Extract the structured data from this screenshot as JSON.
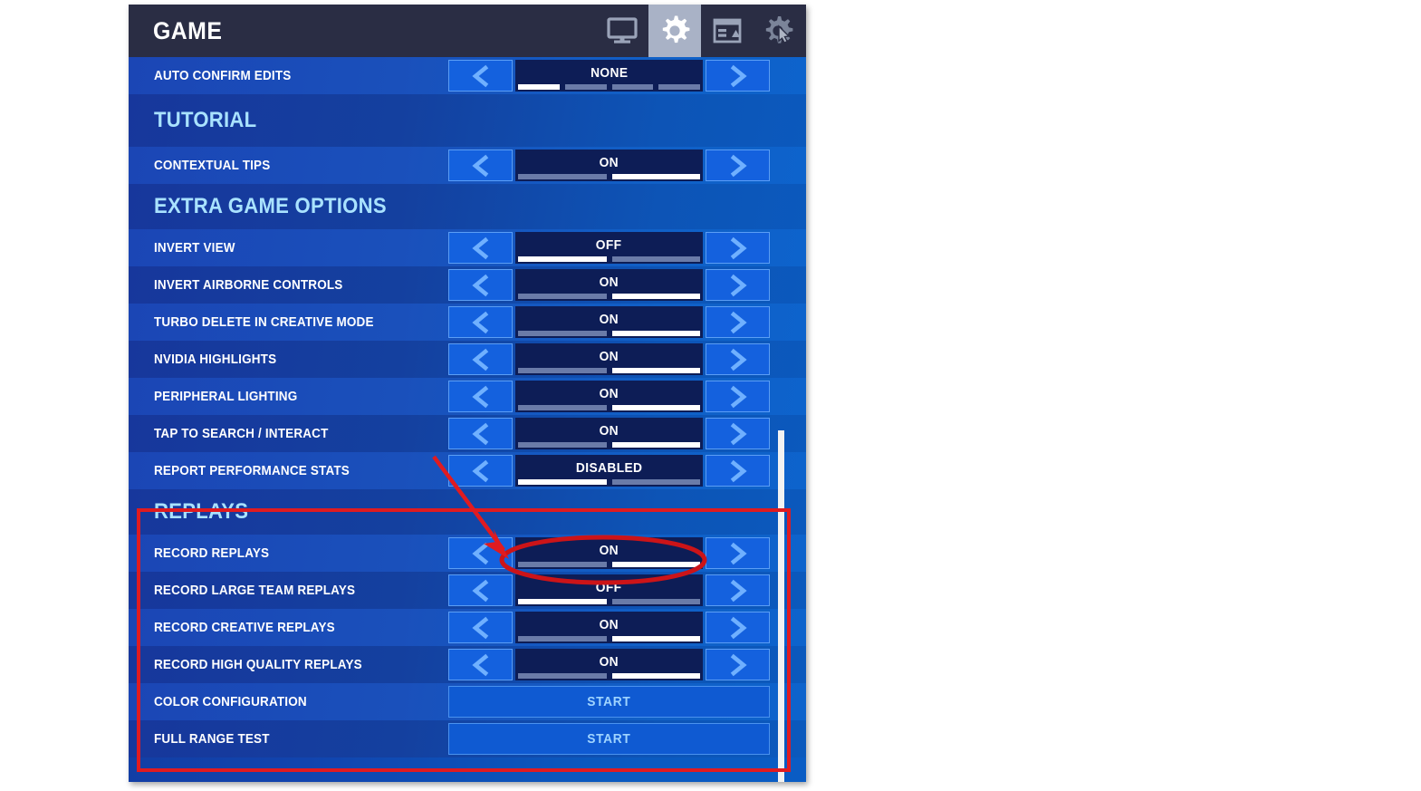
{
  "header": {
    "title": "GAME",
    "icons": [
      {
        "name": "display-icon",
        "label": "Video",
        "active": false
      },
      {
        "name": "gear-icon",
        "label": "Game",
        "active": true
      },
      {
        "name": "hud-layout-icon",
        "label": "HUD Layout",
        "active": false
      },
      {
        "name": "gear-cursor-icon",
        "label": "Input",
        "active": false
      }
    ]
  },
  "colors": {
    "panel_gradient_start": "#123a9e",
    "panel_gradient_end": "#0a5cc4",
    "header_bg": "#2a2d44",
    "section_title": "#a9e2ff",
    "row_label": "#ffffff",
    "value_box_bg": "#0d1d56",
    "arrow_btn_bg": "#1461de",
    "arrow_glyph": "#6fb0ff",
    "segment_active": "#ffffff",
    "segment_inactive": "#6a7ba8",
    "start_text": "#9fd4ff",
    "annotation_red": "#e01b20",
    "scrollbar": "#f2f2f2"
  },
  "rows": [
    {
      "id": "auto-confirm-edits",
      "label": "AUTO CONFIRM EDITS",
      "type": "stepper",
      "value": "NONE",
      "segments": 4,
      "active_segment": 1,
      "shade": "light"
    }
  ],
  "sections": [
    {
      "id": "tutorial",
      "title": "TUTORIAL",
      "rows": [
        {
          "id": "contextual-tips",
          "label": "CONTEXTUAL TIPS",
          "type": "stepper",
          "value": "ON",
          "segments": 2,
          "active_segment": 2,
          "shade": "light"
        }
      ]
    },
    {
      "id": "extra-game-options",
      "title": "EXTRA GAME OPTIONS",
      "rows": [
        {
          "id": "invert-view",
          "label": "INVERT VIEW",
          "type": "stepper",
          "value": "OFF",
          "segments": 2,
          "active_segment": 1,
          "shade": "light"
        },
        {
          "id": "invert-airborne-controls",
          "label": "INVERT AIRBORNE CONTROLS",
          "type": "stepper",
          "value": "ON",
          "segments": 2,
          "active_segment": 2,
          "shade": "dark"
        },
        {
          "id": "turbo-delete-in-creative-mode",
          "label": "TURBO DELETE IN CREATIVE MODE",
          "type": "stepper",
          "value": "ON",
          "segments": 2,
          "active_segment": 2,
          "shade": "light"
        },
        {
          "id": "nvidia-highlights",
          "label": "NVIDIA HIGHLIGHTS",
          "type": "stepper",
          "value": "ON",
          "segments": 2,
          "active_segment": 2,
          "shade": "dark"
        },
        {
          "id": "peripheral-lighting",
          "label": "PERIPHERAL LIGHTING",
          "type": "stepper",
          "value": "ON",
          "segments": 2,
          "active_segment": 2,
          "shade": "light"
        },
        {
          "id": "tap-to-search-interact",
          "label": "TAP TO SEARCH / INTERACT",
          "type": "stepper",
          "value": "ON",
          "segments": 2,
          "active_segment": 2,
          "shade": "dark"
        },
        {
          "id": "report-performance-stats",
          "label": "REPORT PERFORMANCE STATS",
          "type": "stepper",
          "value": "DISABLED",
          "segments": 2,
          "active_segment": 1,
          "shade": "light"
        }
      ]
    },
    {
      "id": "replays",
      "title": "REPLAYS",
      "rows": [
        {
          "id": "record-replays",
          "label": "RECORD REPLAYS",
          "type": "stepper",
          "value": "ON",
          "segments": 2,
          "active_segment": 2,
          "shade": "light"
        },
        {
          "id": "record-large-team-replays",
          "label": "RECORD LARGE TEAM REPLAYS",
          "type": "stepper",
          "value": "OFF",
          "segments": 2,
          "active_segment": 1,
          "shade": "dark"
        },
        {
          "id": "record-creative-replays",
          "label": "RECORD CREATIVE REPLAYS",
          "type": "stepper",
          "value": "ON",
          "segments": 2,
          "active_segment": 2,
          "shade": "light"
        },
        {
          "id": "record-high-quality-replays",
          "label": "RECORD HIGH QUALITY REPLAYS",
          "type": "stepper",
          "value": "ON",
          "segments": 2,
          "active_segment": 2,
          "shade": "dark"
        },
        {
          "id": "color-configuration",
          "label": "COLOR CONFIGURATION",
          "type": "button",
          "value": "START",
          "shade": "light"
        },
        {
          "id": "full-range-test",
          "label": "FULL RANGE TEST",
          "type": "button",
          "value": "START",
          "shade": "dark"
        }
      ]
    }
  ],
  "annotations": {
    "highlight_box_target": "replays",
    "ellipse_target": "record-replays",
    "arrow_points_to": "record-replays"
  }
}
